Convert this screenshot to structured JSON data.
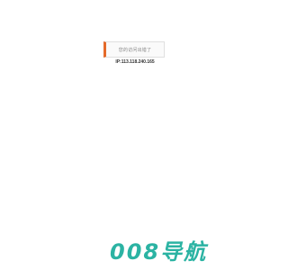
{
  "notice": {
    "text": "您的访问出错了"
  },
  "ip": {
    "text": "IP:113.118.240.165"
  },
  "brand": {
    "logo_text": "008导航"
  },
  "colors": {
    "accent_bar": "#e56a2a",
    "brand": "#2bb3a3"
  }
}
